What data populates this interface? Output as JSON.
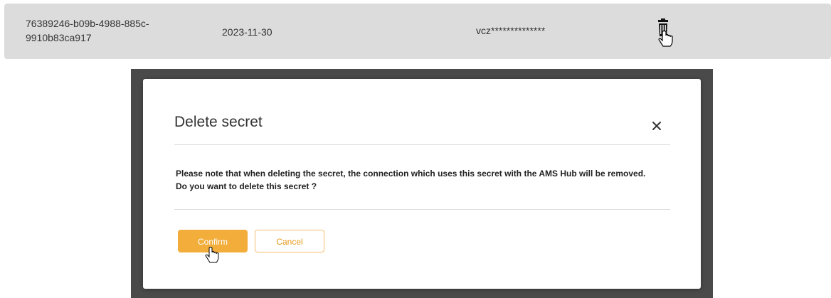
{
  "row": {
    "id": "76389246-b09b-4988-885c-9910b83ca917",
    "date": "2023-11-30",
    "secret": "vcz**************",
    "delete_icon": "trash-icon"
  },
  "modal": {
    "title": "Delete secret",
    "close_icon": "close-icon",
    "message_line1": "Please note that when deleting the secret, the connection which uses this secret with the AMS Hub will be removed.",
    "message_line2": "Do you want to delete this secret ?",
    "confirm_label": "Confirm",
    "cancel_label": "Cancel"
  },
  "colors": {
    "accent": "#f2ad3a",
    "row_bg": "#dcdcdc",
    "overlay": "#4a4a4a"
  }
}
